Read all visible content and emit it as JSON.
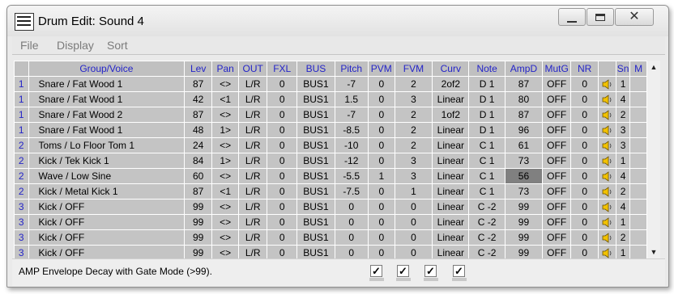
{
  "window": {
    "title": "Drum Edit: Sound 4"
  },
  "menu": [
    "File",
    "Display",
    "Sort"
  ],
  "columns": [
    "Group/Voice",
    "Lev",
    "Pan",
    "OUT",
    "FXL",
    "BUS",
    "Pitch",
    "PVM",
    "FVM",
    "Curv",
    "Note",
    "AmpD",
    "MutG",
    "NR",
    "",
    "Sn",
    "M"
  ],
  "rows": [
    [
      "1",
      "Snare / Fat Wood 1",
      "87",
      "<>",
      "L/R",
      "0",
      "BUS1",
      "-7",
      "0",
      "2",
      "2of2",
      "D 1",
      "87",
      "OFF",
      "0",
      "",
      "1",
      ""
    ],
    [
      "1",
      "Snare / Fat Wood 1",
      "42",
      "<1",
      "L/R",
      "0",
      "BUS1",
      "1.5",
      "0",
      "3",
      "Linear",
      "D 1",
      "80",
      "OFF",
      "0",
      "",
      "4",
      ""
    ],
    [
      "1",
      "Snare / Fat Wood 2",
      "87",
      "<>",
      "L/R",
      "0",
      "BUS1",
      "-7",
      "0",
      "2",
      "1of2",
      "D 1",
      "87",
      "OFF",
      "0",
      "",
      "2",
      ""
    ],
    [
      "1",
      "Snare / Fat Wood 1",
      "48",
      "1>",
      "L/R",
      "0",
      "BUS1",
      "-8.5",
      "0",
      "2",
      "Linear",
      "D 1",
      "96",
      "OFF",
      "0",
      "",
      "3",
      ""
    ],
    [
      "2",
      "Toms / Lo Floor Tom 1",
      "24",
      "<>",
      "L/R",
      "0",
      "BUS1",
      "-10",
      "0",
      "2",
      "Linear",
      "C 1",
      "61",
      "OFF",
      "0",
      "",
      "3",
      ""
    ],
    [
      "2",
      "Kick / Tek Kick 1",
      "84",
      "1>",
      "L/R",
      "0",
      "BUS1",
      "-12",
      "0",
      "3",
      "Linear",
      "C 1",
      "73",
      "OFF",
      "0",
      "",
      "1",
      ""
    ],
    [
      "2",
      "Wave / Low Sine",
      "60",
      "<>",
      "L/R",
      "0",
      "BUS1",
      "-5.5",
      "1",
      "3",
      "Linear",
      "C 1",
      "56",
      "OFF",
      "0",
      "",
      "4",
      ""
    ],
    [
      "2",
      "Kick / Metal Kick 1",
      "87",
      "<1",
      "L/R",
      "0",
      "BUS1",
      "-7.5",
      "0",
      "1",
      "Linear",
      "C 1",
      "73",
      "OFF",
      "0",
      "",
      "2",
      ""
    ],
    [
      "3",
      "Kick / OFF",
      "99",
      "<>",
      "L/R",
      "0",
      "BUS1",
      "0",
      "0",
      "0",
      "Linear",
      "C -2",
      "99",
      "OFF",
      "0",
      "",
      "4",
      ""
    ],
    [
      "3",
      "Kick / OFF",
      "99",
      "<>",
      "L/R",
      "0",
      "BUS1",
      "0",
      "0",
      "0",
      "Linear",
      "C -2",
      "99",
      "OFF",
      "0",
      "",
      "1",
      ""
    ],
    [
      "3",
      "Kick / OFF",
      "99",
      "<>",
      "L/R",
      "0",
      "BUS1",
      "0",
      "0",
      "0",
      "Linear",
      "C -2",
      "99",
      "OFF",
      "0",
      "",
      "2",
      ""
    ],
    [
      "3",
      "Kick / OFF",
      "99",
      "<>",
      "L/R",
      "0",
      "BUS1",
      "0",
      "0",
      "0",
      "Linear",
      "C -2",
      "99",
      "OFF",
      "0",
      "",
      "1",
      ""
    ]
  ],
  "highlight": {
    "row": 6,
    "col": 12
  },
  "status": {
    "text": "AMP Envelope Decay with Gate Mode (>99).",
    "checkbox_mark": "✓",
    "checkboxes": [
      true,
      true,
      true,
      true
    ]
  }
}
